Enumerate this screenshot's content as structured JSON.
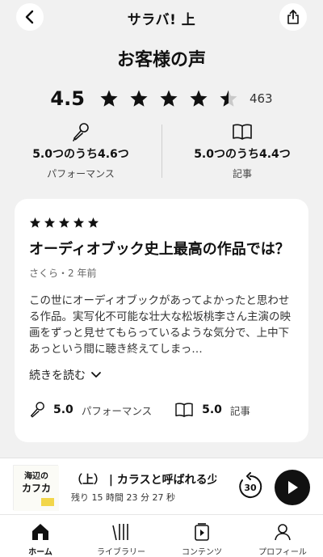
{
  "header": {
    "title": "サラバ! 上"
  },
  "page_title": "お客様の声",
  "rating": {
    "value": "4.5",
    "stars": 4.5,
    "count": "463"
  },
  "subratings": [
    {
      "value": "5.0つのうち4.6つ",
      "label": "パフォーマンス",
      "icon": "microphone-icon"
    },
    {
      "value": "5.0つのうち4.4つ",
      "label": "記事",
      "icon": "book-icon"
    }
  ],
  "review": {
    "stars": 5,
    "title": "オーディオブック史上最高の作品では？",
    "meta": "さくら・2 年前",
    "body": "この世にオーディオブックがあってよかったと思わせる作品。実写化不可能な壮大な松坂桃李さん主演の映画をずっと見せてもらっているような気分で、上中下あっという間に聴き終えてしまっ…",
    "read_more": "続きを読む",
    "performance_score": "5.0",
    "performance_label": "パフォーマンス",
    "story_score": "5.0",
    "story_label": "記事"
  },
  "player": {
    "title": "（上） | カラスと呼ばれる少",
    "remaining": "残り 15 時間 23 分 27 秒",
    "skip_seconds": "30",
    "cover_text": "海辺のカフカ"
  },
  "tabs": [
    {
      "label": "ホーム",
      "icon": "home-icon",
      "active": true
    },
    {
      "label": "ライブラリー",
      "icon": "library-icon",
      "active": false
    },
    {
      "label": "コンテンツ",
      "icon": "content-icon",
      "active": false
    },
    {
      "label": "プロフィール",
      "icon": "profile-icon",
      "active": false
    }
  ]
}
